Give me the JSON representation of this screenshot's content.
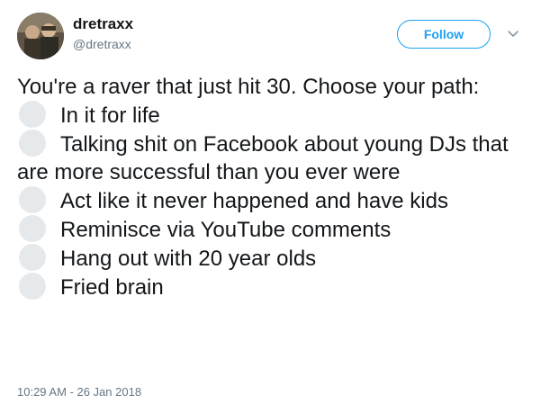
{
  "author": {
    "display_name": "dretraxx",
    "handle": "@dretraxx"
  },
  "follow_label": "Follow",
  "tweet": {
    "prompt": "You're a raver that just hit 30. Choose your path:",
    "options": [
      "In it for life",
      "Talking shit on Facebook about young DJs that are more successful than you ever were",
      "Act like it never happened and have kids",
      "Reminisce via YouTube comments",
      "Hang out with 20 year olds",
      "Fried brain"
    ]
  },
  "timestamp": "10:29 AM - 26 Jan 2018",
  "colors": {
    "accent": "#1da1f2",
    "text": "#14171a",
    "secondary_text": "#657786",
    "option_circle": "#e6e9ec"
  }
}
